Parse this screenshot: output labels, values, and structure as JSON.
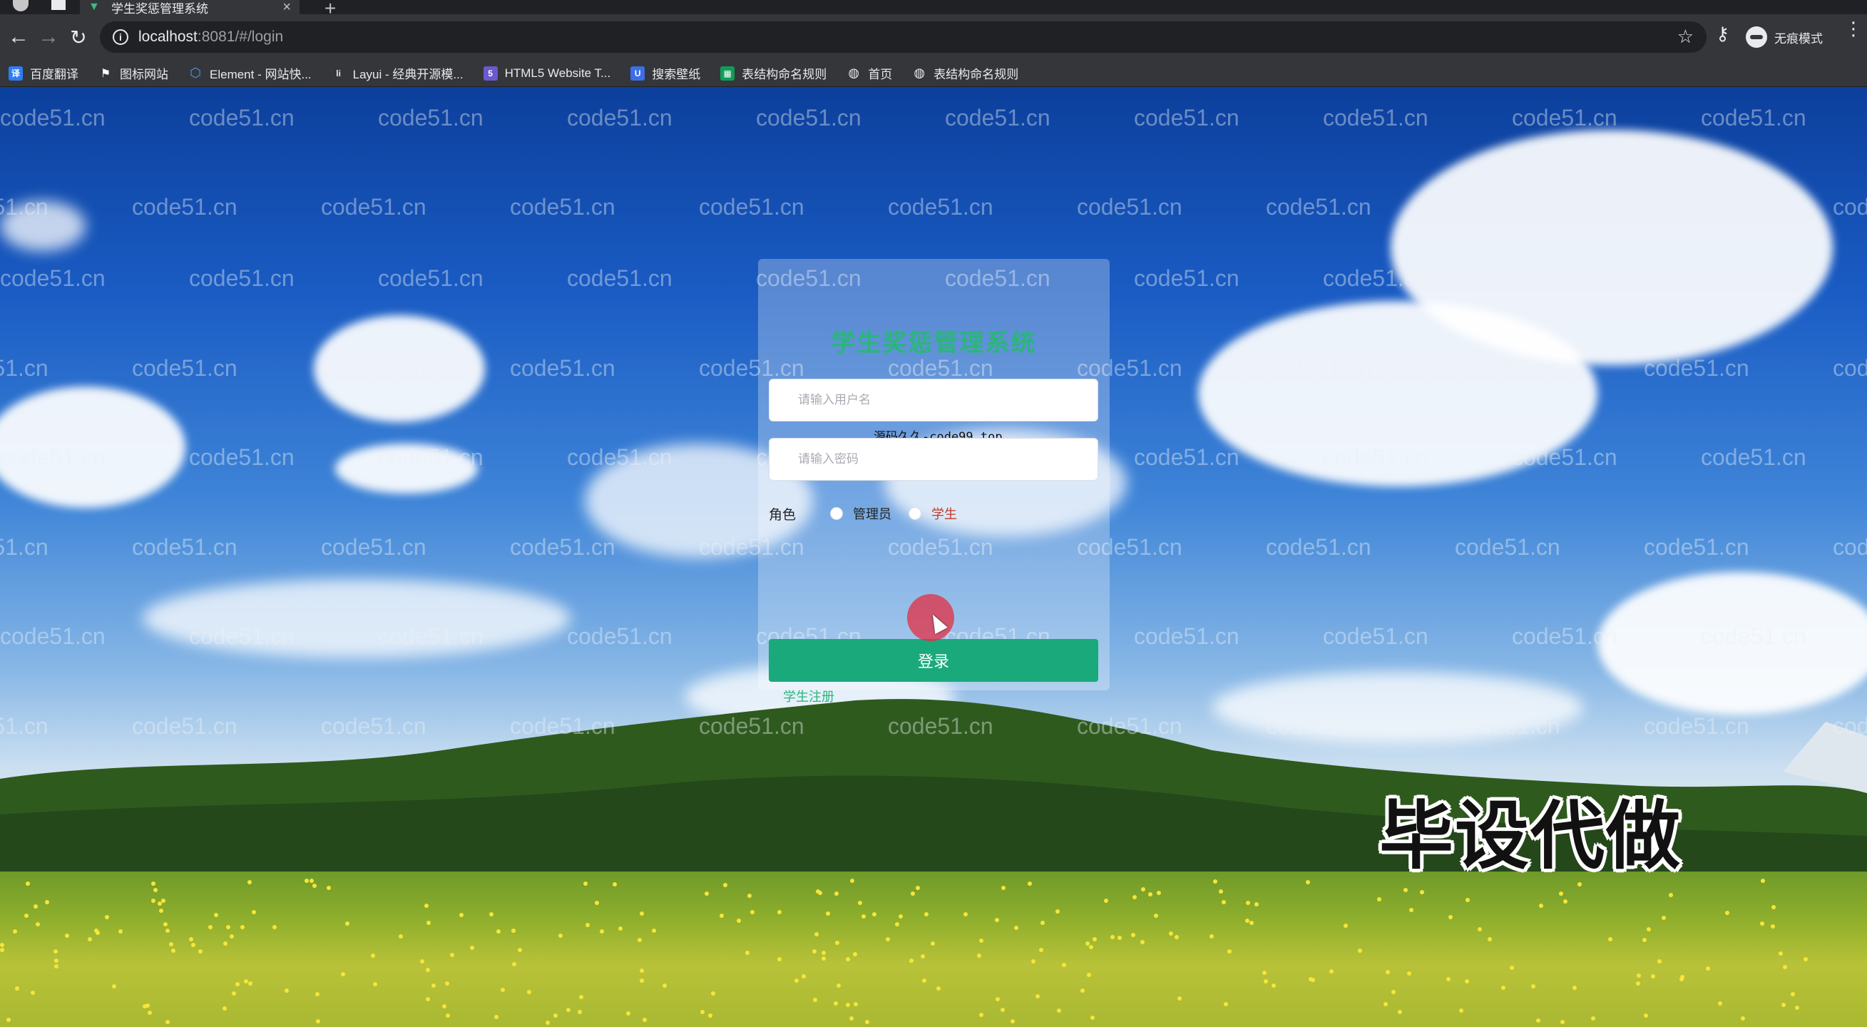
{
  "browser": {
    "tab_title": "学生奖惩管理系统",
    "url_host": "localhost",
    "url_path": ":8081/#/login",
    "incognito_label": "无痕模式",
    "bookmarks": [
      {
        "label": "百度翻译",
        "icon": "baidu-translate-icon",
        "color": "#2d7cf6"
      },
      {
        "label": "图标网站",
        "icon": "flag-icon",
        "color": "#ffffff"
      },
      {
        "label": "Element - 网站快...",
        "icon": "element-icon",
        "color": "#409eff"
      },
      {
        "label": "Layui - 经典开源模...",
        "icon": "layui-icon",
        "color": "#009688"
      },
      {
        "label": "HTML5 Website T...",
        "icon": "html5-icon",
        "color": "#6a5acd"
      },
      {
        "label": "搜索壁纸",
        "icon": "wallpaper-icon",
        "color": "#3b6ee8"
      },
      {
        "label": "表结构命名规则",
        "icon": "sheet-icon",
        "color": "#0f9d58"
      },
      {
        "label": "首页",
        "icon": "globe-icon",
        "color": "#e8eaed"
      },
      {
        "label": "表结构命名规则",
        "icon": "globe-icon",
        "color": "#e8eaed"
      }
    ]
  },
  "login": {
    "title": "学生奖惩管理系统",
    "username_placeholder": "请输入用户名",
    "password_placeholder": "请输入密码",
    "role_label": "角色",
    "roles": [
      "管理员",
      "学生"
    ],
    "login_button": "登录",
    "register_link": "学生注册",
    "overlay_hint": "源码久久-code99.top"
  },
  "watermark_text": "code51.cn",
  "promo_text": "毕设代做",
  "colors": {
    "accent": "#1aa97b",
    "title_green": "#2ab67a",
    "chrome_dark": "#202124",
    "chrome_toolbar": "#35363a"
  }
}
